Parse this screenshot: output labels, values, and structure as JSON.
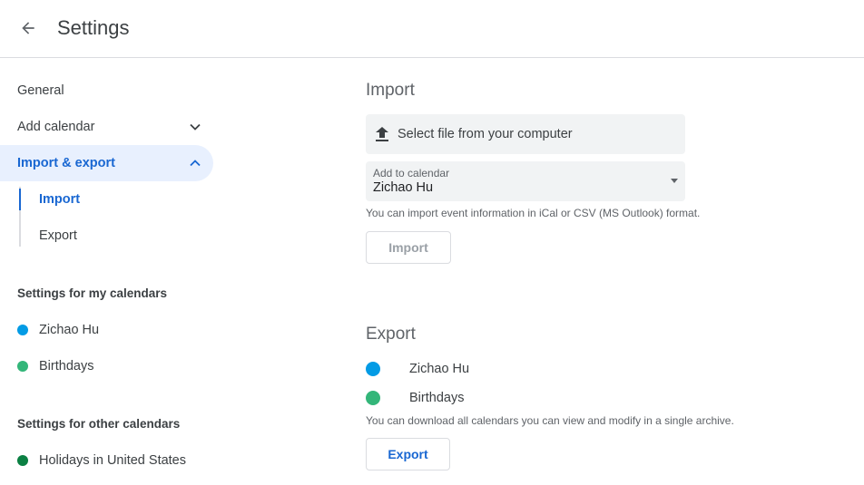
{
  "header": {
    "title": "Settings",
    "back_icon": "arrow-back-icon"
  },
  "sidebar": {
    "general": "General",
    "add_calendar": "Add calendar",
    "import_export": "Import & export",
    "sub_items": [
      "Import",
      "Export"
    ],
    "my_calendars_heading": "Settings for my calendars",
    "my_calendars": [
      {
        "name": "Zichao Hu",
        "color": "#039be5"
      },
      {
        "name": "Birthdays",
        "color": "#33b679"
      }
    ],
    "other_calendars_heading": "Settings for other calendars",
    "other_calendars": [
      {
        "name": "Holidays in United States",
        "color": "#0b8043"
      }
    ]
  },
  "import": {
    "title": "Import",
    "file_picker_label": "Select file from your computer",
    "file_picker_icon": "upload-icon",
    "select_caption": "Add to calendar",
    "select_value": "Zichao Hu",
    "hint": "You can import event information in iCal or CSV (MS Outlook) format.",
    "button": "Import"
  },
  "export": {
    "title": "Export",
    "calendars": [
      {
        "name": "Zichao Hu",
        "color": "#039be5"
      },
      {
        "name": "Birthdays",
        "color": "#33b679"
      }
    ],
    "hint": "You can download all calendars you can view and modify in a single archive.",
    "button": "Export"
  },
  "colors": {
    "accent": "#1967d2",
    "active_bg": "#e8f0fe"
  }
}
